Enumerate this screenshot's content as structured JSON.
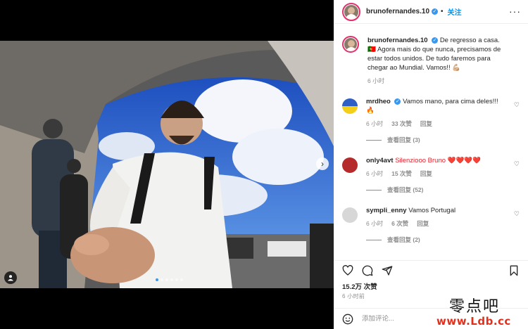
{
  "post": {
    "username": "brunofernandes.10",
    "follow_label": "关注",
    "separator": "•",
    "more_label": "···",
    "caption": "De regresso a casa. 🇵🇹 Agora mais do que nunca, precisamos de estar todos unidos. De tudo faremos para chegar ao Mundial. Vamos!! 💪🏼",
    "caption_time": "6 小时",
    "likes": "15.2万 次赞",
    "time": "6 小时前",
    "add_comment_placeholder": "添加评论..."
  },
  "comments": [
    {
      "username": "mrdheo",
      "verified": true,
      "text": "Vamos mano, para cima deles!!! 🔥",
      "time": "6 小时",
      "likes": "33 次赞",
      "reply": "回复",
      "replies": "查看回复 (3)"
    },
    {
      "username": "only4avt",
      "verified": false,
      "text": "Silenziooo Bruno ❤️❤️❤️❤️",
      "time": "6 小时",
      "likes": "15 次赞",
      "reply": "回复",
      "replies": "查看回复 (52)"
    },
    {
      "username": "sympli_enny",
      "verified": false,
      "text": "Vamos Portugal",
      "time": "6 小时",
      "likes": "6 次赞",
      "reply": "回复",
      "replies": "查看回复 (2)"
    }
  ],
  "carousel": {
    "count": 6,
    "active": 0
  },
  "watermark": {
    "line1": "零点吧",
    "line2": "www.Ldb.cc"
  },
  "icons": [
    "heart-icon",
    "comment-icon",
    "share-icon",
    "bookmark-icon",
    "emoji-icon",
    "user-tag-icon",
    "next-icon",
    "more-icon",
    "verified-icon"
  ],
  "colors": {
    "accent": "#0095f6",
    "verified": "#3897f0",
    "ring": "#e1306c",
    "muted": "#8e8e8e"
  }
}
